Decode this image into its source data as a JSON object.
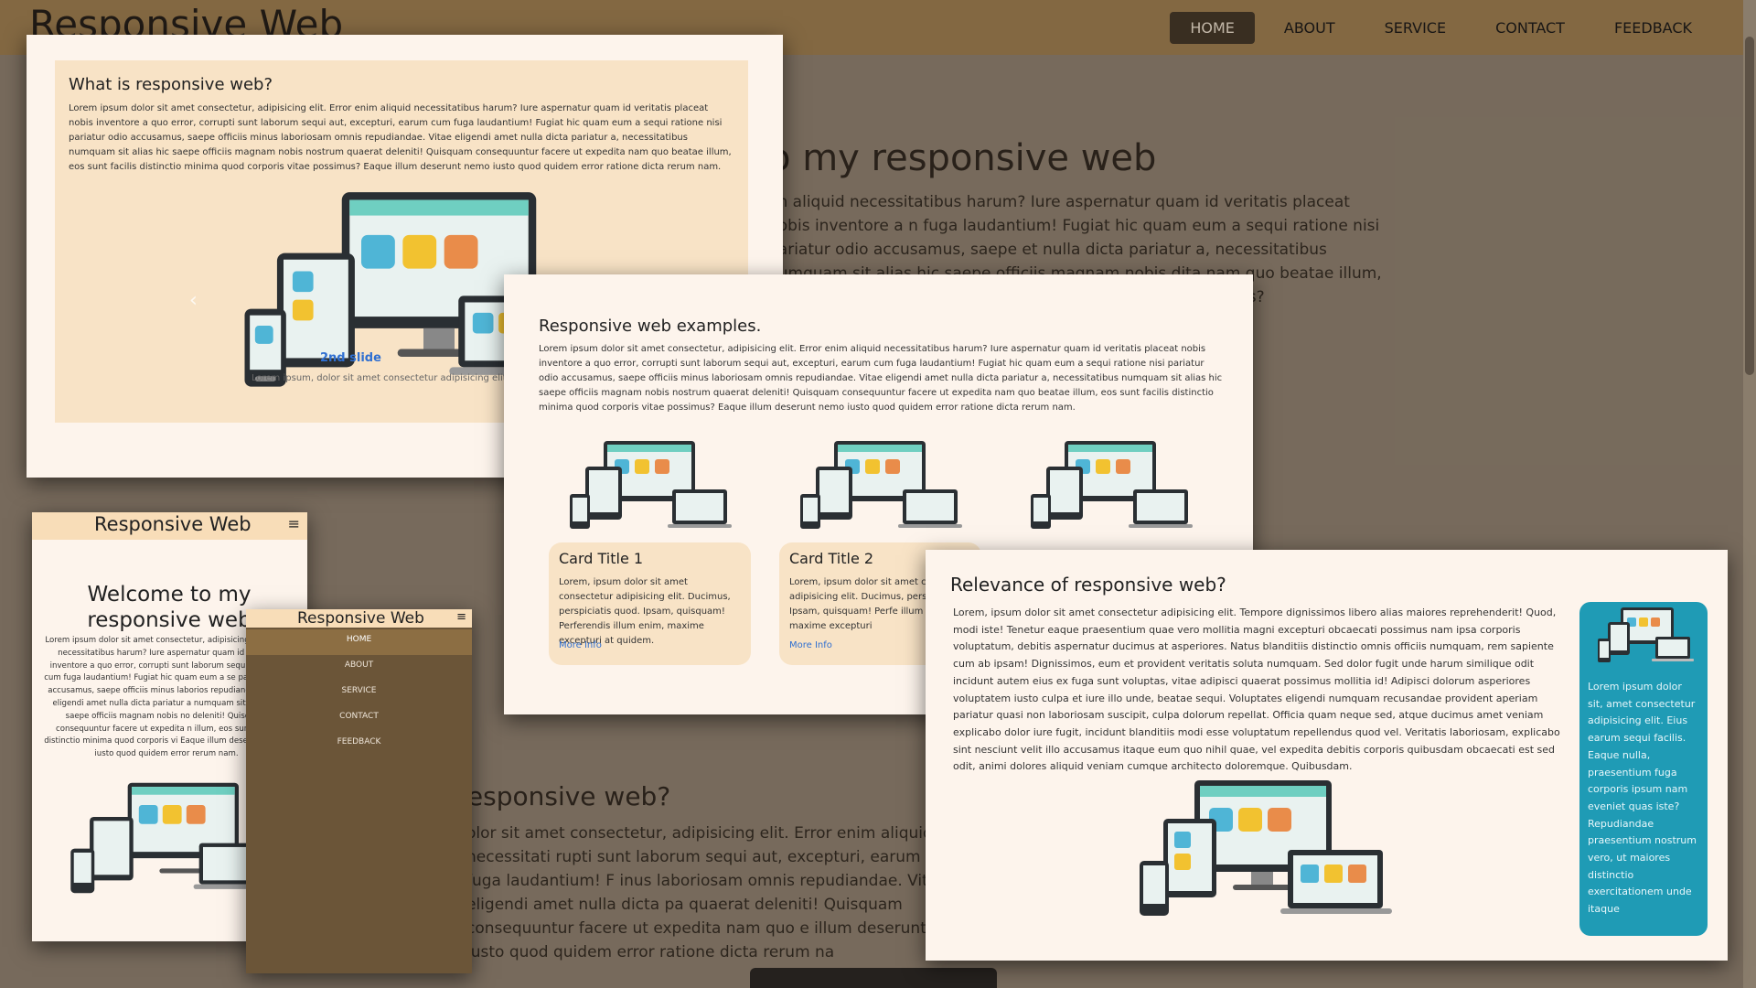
{
  "background_page": {
    "brand": "Responsive Web",
    "nav": [
      {
        "label": "HOME",
        "active": true
      },
      {
        "label": "ABOUT",
        "active": false
      },
      {
        "label": "SERVICE",
        "active": false
      },
      {
        "label": "CONTACT",
        "active": false
      },
      {
        "label": "FEEDBACK",
        "active": false
      }
    ],
    "welcome_heading": "o my responsive web",
    "welcome_text": "im aliquid necessitatibus harum? Iure aspernatur quam id veritatis placeat nobis inventore a n fuga laudantium! Fugiat hic quam eum a sequi ratione nisi pariatur odio accusamus, saepe et nulla dicta pariatur a, necessitatibus numquam sit alias hic saepe officiis magnam nobis dita nam quo beatae illum, eos sunt facilis distinctio minima quod corporis vitae possimus?",
    "lower_heading": "responsive web?",
    "lower_text": "olor sit amet consectetur, adipisicing elit. Error enim aliquid necessitati rupti sunt laborum sequi aut, excepturi, earum cum fuga laudantium! F inus laboriosam omnis repudiandae. Vitae eligendi amet nulla dicta pa quaerat deleniti! Quisquam consequuntur facere ut expedita nam quo e illum deserunt nemo iusto quod quidem error ratione dicta rerum na"
  },
  "panel_what": {
    "title": "What is responsive web?",
    "text": "Lorem ipsum dolor sit amet consectetur, adipisicing elit. Error enim aliquid necessitatibus harum? Iure aspernatur quam id veritatis placeat nobis inventore a quo error, corrupti sunt laborum sequi aut, excepturi, earum cum fuga laudantium! Fugiat hic quam eum a sequi ratione nisi pariatur odio accusamus, saepe officiis minus laboriosam omnis repudiandae. Vitae eligendi amet nulla dicta pariatur a, necessitatibus numquam sit alias hic saepe officiis magnam nobis nostrum quaerat deleniti! Quisquam consequuntur facere ut expedita nam quo beatae illum, eos sunt facilis distinctio minima quod corporis vitae possimus? Eaque illum deserunt nemo iusto quod quidem error ratione dicta rerum nam.",
    "prev_icon": "‹",
    "slide_caption": "2nd slide",
    "slide_text": "Lorem ipsum, dolor sit amet consectetur adipisicing elit. Ha"
  },
  "panel_examples": {
    "title": "Responsive web examples.",
    "text": "Lorem ipsum dolor sit amet consectetur, adipisicing elit. Error enim aliquid necessitatibus harum? Iure aspernatur quam id veritatis placeat nobis inventore a quo error, corrupti sunt laborum sequi aut, excepturi, earum cum fuga laudantium! Fugiat hic quam eum a sequi ratione nisi pariatur odio accusamus, saepe officiis minus laboriosam omnis repudiandae. Vitae eligendi amet nulla dicta pariatur a, necessitatibus numquam sit alias hic saepe officiis magnam nobis nostrum quaerat deleniti! Quisquam consequuntur facere ut expedita nam quo beatae illum, eos sunt facilis distinctio minima quod corporis vitae possimus? Eaque illum deserunt nemo iusto quod quidem error ratione dicta rerum nam.",
    "cards": [
      {
        "title": "Card Title 1",
        "text": "Lorem, ipsum dolor sit amet consectetur adipisicing elit. Ducimus, perspiciatis quod. Ipsam, quisquam! Perferendis illum enim, maxime excepturi at quidem.",
        "link": "More Info"
      },
      {
        "title": "Card Title 2",
        "text": "Lorem, ipsum dolor sit amet co adipisicing elit. Ducimus, persp quod. Ipsam, quisquam! Perfe illum enim, maxime excepturi",
        "link": "More Info"
      }
    ]
  },
  "panel_relevance": {
    "title": "Relevance of responsive web?",
    "text": "Lorem, ipsum dolor sit amet consectetur adipisicing elit. Tempore dignissimos libero alias maiores reprehenderit! Quod, modi iste! Tenetur eaque praesentium quae vero mollitia magni excepturi obcaecati possimus nam ipsa corporis voluptatum, debitis aspernatur ducimus at asperiores. Natus blanditiis distinctio omnis officiis numquam, rem sapiente cum ab ipsam! Dignissimos, eum et provident veritatis soluta numquam. Sed dolor fugit unde harum similique odit incidunt autem eius ex fuga sunt voluptas, vitae adipisci quaerat possimus mollitia id! Adipisci dolorum asperiores voluptatem iusto culpa et iure illo unde, beatae sequi. Voluptates eligendi numquam recusandae provident aperiam pariatur quasi non laboriosam suscipit, culpa dolorum repellat. Officia quam neque sed, atque ducimus amet veniam explicabo dolor iure fugit, incidunt blanditiis modi esse voluptatum repellendus quod vel. Veritatis laboriosam, explicabo sint nesciunt velit illo accusamus itaque eum quo nihil quae, vel expedita debitis corporis quibusdam obcaecati est sed odit, animi dolores aliquid veniam cumque architecto doloremque. Quibusdam.",
    "side_text": "Lorem ipsum dolor sit, amet consectetur adipisicing elit. Eius earum sequi facilis. Eaque nulla, praesentium fuga corporis ipsum nam eveniet quas iste? Repudiandae praesentium nostrum vero, ut maiores distinctio exercitationem unde itaque"
  },
  "panel_mobile": {
    "brand": "Responsive Web",
    "menu_icon": "≡",
    "heading": "Welcome to my responsive web",
    "text": "Lorem ipsum dolor sit amet consectetur, adipisicing el aliquid necessitatibus harum? Iure aspernatur quam id v nobis inventore a quo error, corrupti sunt laborum sequi a earum cum fuga laudantium! Fugiat hic quam eum a se pariatur odio accusamus, saepe officiis minus laborios repudiandae. Vitae eligendi amet nulla dicta pariatur a numquam sit alias hic saepe officiis magnam nobis no deleniti! Quisquam consequuntur facere ut expedita n illum, eos sunt facilis distinctio minima quod corporis vi Eaque illum deserunt nemo iusto quod quidem error rerum nam."
  },
  "panel_mobile_menu": {
    "brand": "Responsive Web",
    "menu_icon": "≡",
    "items": [
      {
        "label": "HOME",
        "active": true
      },
      {
        "label": "ABOUT",
        "active": false
      },
      {
        "label": "SERVICE",
        "active": false
      },
      {
        "label": "CONTACT",
        "active": false
      },
      {
        "label": "FEEDBACK",
        "active": false
      }
    ]
  }
}
